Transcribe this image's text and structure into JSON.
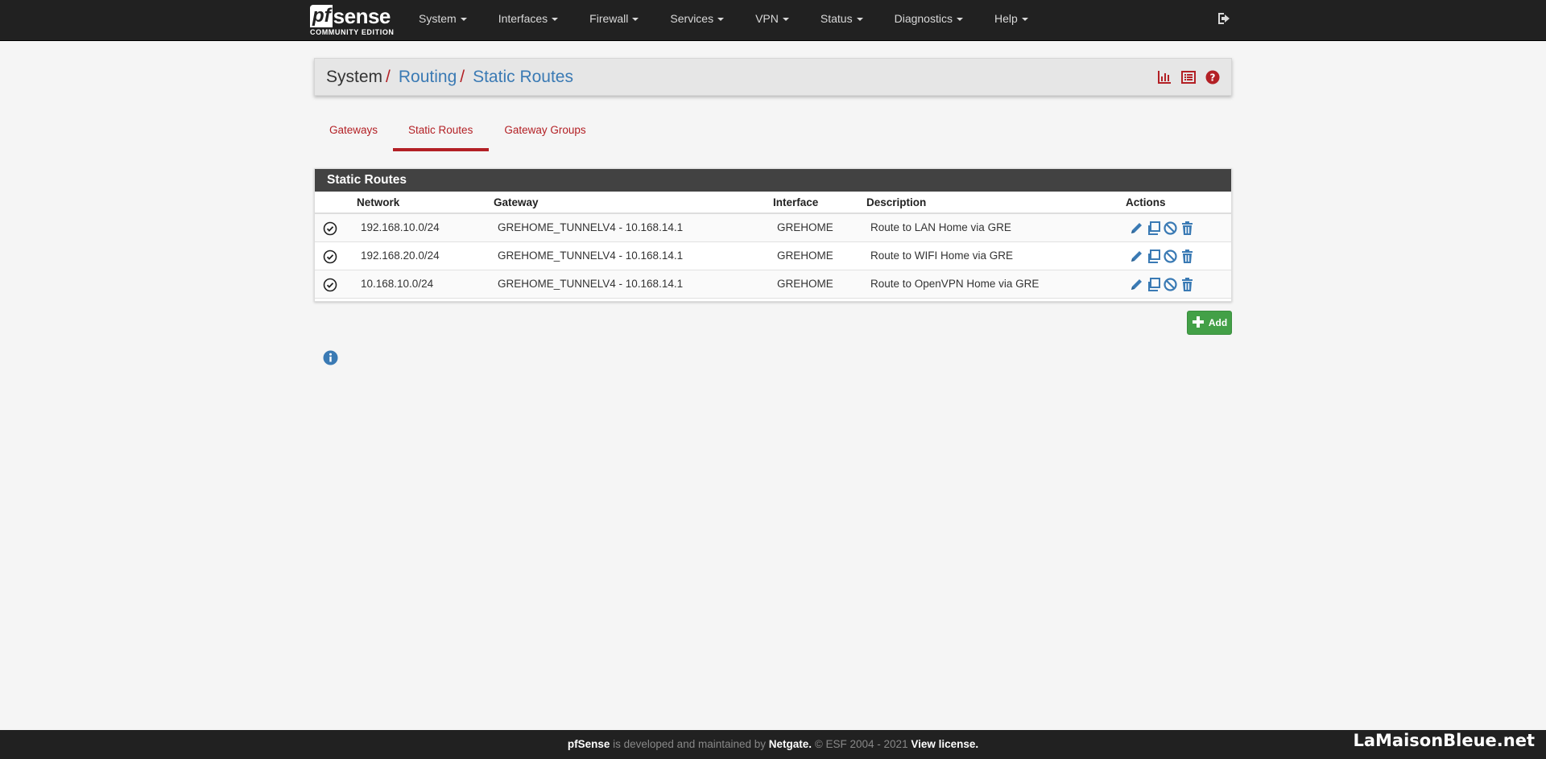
{
  "brand": {
    "pf": "pf",
    "sense": "sense",
    "edition": "COMMUNITY EDITION"
  },
  "nav": {
    "items": [
      "System",
      "Interfaces",
      "Firewall",
      "Services",
      "VPN",
      "Status",
      "Diagnostics",
      "Help"
    ],
    "logout_icon": "sign-out-icon"
  },
  "breadcrumb": {
    "root": "System",
    "sep1": "/",
    "link1": "Routing",
    "sep2": "/",
    "link2": "Static Routes",
    "icons": [
      "bar-chart-icon",
      "list-icon",
      "help-icon"
    ]
  },
  "tabs": [
    {
      "label": "Gateways",
      "active": false
    },
    {
      "label": "Static Routes",
      "active": true
    },
    {
      "label": "Gateway Groups",
      "active": false
    }
  ],
  "table": {
    "title": "Static Routes",
    "headers": {
      "network": "Network",
      "gateway": "Gateway",
      "interface": "Interface",
      "description": "Description",
      "actions": "Actions"
    },
    "rows": [
      {
        "network": "192.168.10.0/24",
        "gateway": "GREHOME_TUNNELV4 - 10.168.14.1",
        "interface": "GREHOME",
        "description": "Route to LAN Home via GRE"
      },
      {
        "network": "192.168.20.0/24",
        "gateway": "GREHOME_TUNNELV4 - 10.168.14.1",
        "interface": "GREHOME",
        "description": "Route to WIFI Home via GRE"
      },
      {
        "network": "10.168.10.0/24",
        "gateway": "GREHOME_TUNNELV4 - 10.168.14.1",
        "interface": "GREHOME",
        "description": "Route to OpenVPN Home via GRE"
      }
    ],
    "action_icons": [
      "pencil-icon",
      "copy-icon",
      "disable-icon",
      "trash-icon"
    ]
  },
  "add_button": {
    "label": "Add"
  },
  "footer": {
    "brand": "pfSense",
    "text1": "is developed and maintained by",
    "company": "Netgate.",
    "text2": "© ESF 2004 - 2021",
    "license": "View license."
  },
  "watermark": "LaMaisonBleue.net",
  "colors": {
    "navbar": "#212121",
    "accent_red": "#b32025",
    "link_blue": "#3a7ab4",
    "add_green": "#43a047",
    "panel_heading": "#424242"
  }
}
